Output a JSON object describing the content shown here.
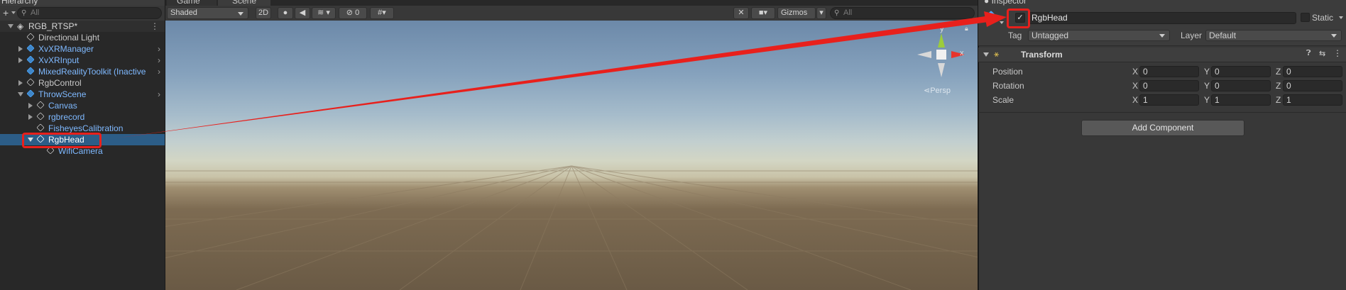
{
  "hierarchy": {
    "tab_label": "Hierarchy",
    "search_placeholder": "All",
    "items": [
      {
        "label": "RGB_RTSP*"
      },
      {
        "label": "Directional Light"
      },
      {
        "label": "XvXRManager"
      },
      {
        "label": "XvXRInput"
      },
      {
        "label": "MixedRealityToolkit (Inactive"
      },
      {
        "label": "RgbControl"
      },
      {
        "label": "ThrowScene"
      },
      {
        "label": "Canvas"
      },
      {
        "label": "rgbrecord"
      },
      {
        "label": "FisheyesCalibration"
      },
      {
        "label": "RgbHead"
      },
      {
        "label": "WifiCamera"
      }
    ]
  },
  "scene": {
    "tabs": [
      "Game",
      "Scene"
    ],
    "shading_mode": "Shaded",
    "mode_2d": "2D",
    "hidden_count": "0",
    "gizmos_label": "Gizmos",
    "search_placeholder": "All",
    "persp_label": "Persp",
    "axis_y": "y",
    "axis_x": "x"
  },
  "inspector": {
    "tab_label": "Inspector",
    "object_name": "RgbHead",
    "static_label": "Static",
    "tag_label": "Tag",
    "tag_value": "Untagged",
    "layer_label": "Layer",
    "layer_value": "Default",
    "transform_title": "Transform",
    "rows": [
      {
        "label": "Position",
        "x": "0",
        "y": "0",
        "z": "0"
      },
      {
        "label": "Rotation",
        "x": "0",
        "y": "0",
        "z": "0"
      },
      {
        "label": "Scale",
        "x": "1",
        "y": "1",
        "z": "1"
      }
    ],
    "axis_labels": {
      "x": "X",
      "y": "Y",
      "z": "Z"
    },
    "add_component_label": "Add Component"
  },
  "colors": {
    "highlight_box": "#e8201c",
    "selection": "#2c5d87",
    "prefab_text": "#7fb9ff"
  }
}
